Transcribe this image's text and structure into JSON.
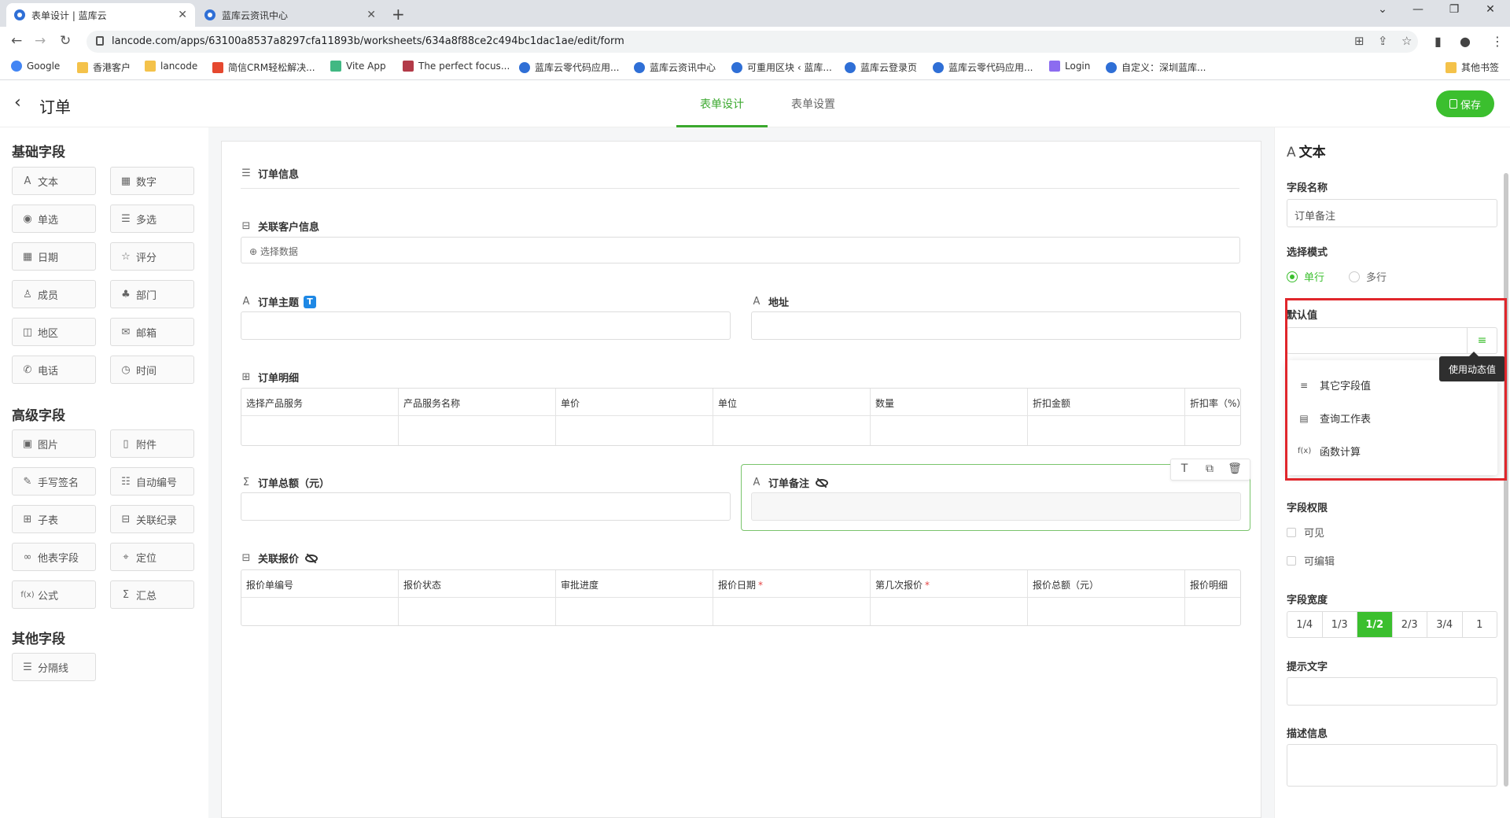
{
  "browser": {
    "tabs": [
      {
        "title": "表单设计 | 蓝库云"
      },
      {
        "title": "蓝库云资讯中心"
      }
    ],
    "url": "lancode.com/apps/63100a8537a8297cfa11893b/worksheets/634a8f88ce2c494bc1dac1ae/edit/form",
    "bookmarks": [
      "Google",
      "香港客户",
      "lancode",
      "简信CRM轻松解决...",
      "Vite App",
      "The perfect focus...",
      "蓝库云零代码应用...",
      "蓝库云资讯中心",
      "可重用区块 ‹ 蓝库...",
      "蓝库云登录页",
      "蓝库云零代码应用...",
      "Login",
      "自定义：深圳蓝库..."
    ],
    "other_bookmarks": "其他书签"
  },
  "header": {
    "title": "订单",
    "tabs": [
      "表单设计",
      "表单设置"
    ],
    "save_label": "保存"
  },
  "left": {
    "basic_title": "基础字段",
    "basic": [
      {
        "icon": "A",
        "label": "文本"
      },
      {
        "icon": "▦",
        "label": "数字"
      },
      {
        "icon": "◉",
        "label": "单选"
      },
      {
        "icon": "☰",
        "label": "多选"
      },
      {
        "icon": "▦",
        "label": "日期"
      },
      {
        "icon": "☆",
        "label": "评分"
      },
      {
        "icon": "♙",
        "label": "成员"
      },
      {
        "icon": "♣",
        "label": "部门"
      },
      {
        "icon": "◫",
        "label": "地区"
      },
      {
        "icon": "✉",
        "label": "邮箱"
      },
      {
        "icon": "✆",
        "label": "电话"
      },
      {
        "icon": "◷",
        "label": "时间"
      }
    ],
    "advanced_title": "高级字段",
    "advanced": [
      {
        "icon": "▣",
        "label": "图片"
      },
      {
        "icon": "▯",
        "label": "附件"
      },
      {
        "icon": "✎",
        "label": "手写签名"
      },
      {
        "icon": "☷",
        "label": "自动编号"
      },
      {
        "icon": "⊞",
        "label": "子表"
      },
      {
        "icon": "⊟",
        "label": "关联纪录"
      },
      {
        "icon": "∞",
        "label": "他表字段"
      },
      {
        "icon": "⌖",
        "label": "定位"
      },
      {
        "icon": "f(x)",
        "label": "公式"
      },
      {
        "icon": "Σ",
        "label": "汇总"
      }
    ],
    "other_title": "其他字段",
    "other": [
      {
        "icon": "☰",
        "label": "分隔线"
      }
    ]
  },
  "form": {
    "section_title": "订单信息",
    "related_customer": {
      "label": "关联客户信息",
      "select_text": "选择数据"
    },
    "order_subject": {
      "label": "订单主题",
      "badge": "T"
    },
    "address": {
      "label": "地址"
    },
    "order_detail": {
      "label": "订单明细",
      "columns": [
        "选择产品服务",
        "产品服务名称",
        "单价",
        "单位",
        "数量",
        "折扣金额",
        "折扣率（%）"
      ]
    },
    "order_total": {
      "label": "订单总额（元）"
    },
    "order_note": {
      "label": "订单备注"
    },
    "related_quote": {
      "label": "关联报价",
      "columns": [
        {
          "name": "报价单编号",
          "required": ""
        },
        {
          "name": "报价状态",
          "required": ""
        },
        {
          "name": "审批进度",
          "required": ""
        },
        {
          "name": "报价日期",
          "required": "*"
        },
        {
          "name": "第几次报价",
          "required": "*"
        },
        {
          "name": "报价总额（元）",
          "required": ""
        },
        {
          "name": "报价明细",
          "required": ""
        }
      ]
    }
  },
  "right": {
    "title": "文本",
    "field_name_label": "字段名称",
    "field_name_value": "订单备注",
    "mode_label": "选择模式",
    "mode_single": "单行",
    "mode_multi": "多行",
    "default_label": "默认值",
    "dynamic_tooltip": "使用动态值",
    "menu": [
      {
        "icon": "≡",
        "label": "其它字段值"
      },
      {
        "icon": "▤",
        "label": "查询工作表"
      },
      {
        "icon": "f(x)",
        "label": "函数计算"
      }
    ],
    "perm_label": "字段权限",
    "perm_visible": "可见",
    "perm_editable": "可编辑",
    "width_label": "字段宽度",
    "width_options": [
      "1/4",
      "1/3",
      "1/2",
      "2/3",
      "3/4",
      "1"
    ],
    "width_selected": "1/2",
    "hint_label": "提示文字",
    "desc_label": "描述信息"
  },
  "colors": {
    "accent": "#3bbf2e",
    "highlight": "#e0262b",
    "badge": "#1e88e5"
  }
}
